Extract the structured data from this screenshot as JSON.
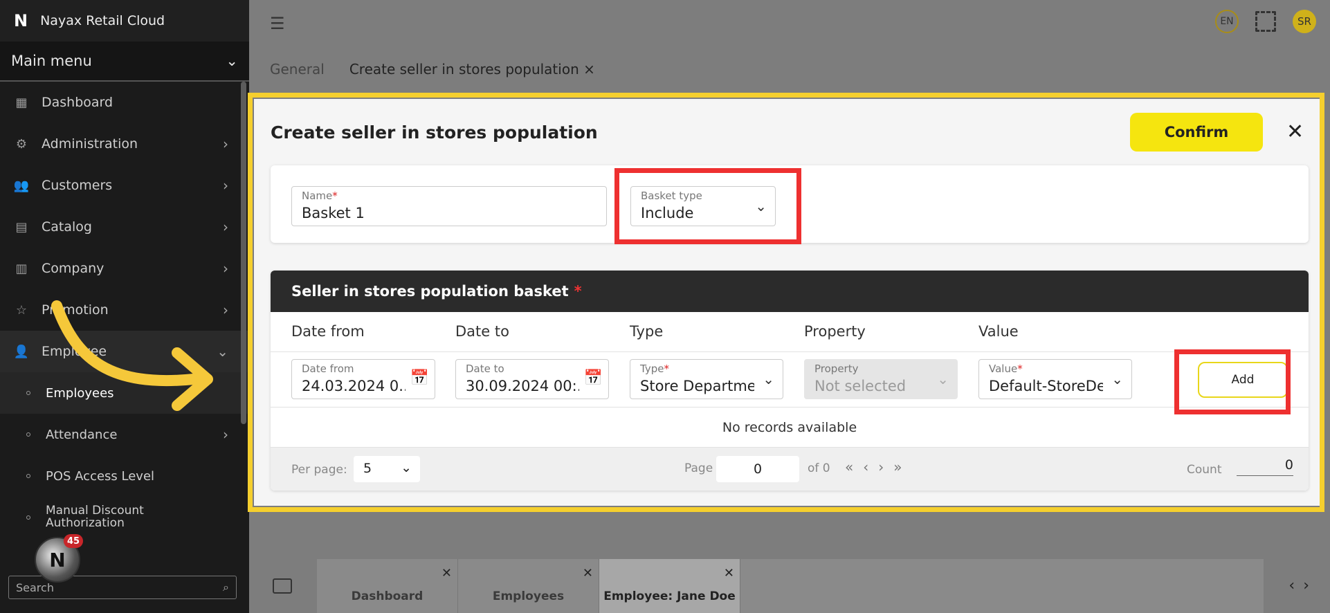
{
  "app": {
    "logo": "N",
    "title": "Nayax Retail Cloud"
  },
  "sidebar": {
    "main_menu": "Main menu",
    "items": [
      {
        "label": "Dashboard",
        "icon": "dashboard-icon"
      },
      {
        "label": "Administration",
        "icon": "gear-icon"
      },
      {
        "label": "Customers",
        "icon": "users-icon"
      },
      {
        "label": "Catalog",
        "icon": "grid-icon"
      },
      {
        "label": "Company",
        "icon": "building-icon"
      },
      {
        "label": "Promotion",
        "icon": "star-icon"
      },
      {
        "label": "Employee",
        "icon": "user-icon"
      }
    ],
    "subitems": [
      "Employees",
      "Attendance",
      "POS Access Level",
      "Manual Discount Authorization"
    ],
    "search_placeholder": "Search",
    "badge": "45"
  },
  "topbar": {
    "lang": "EN",
    "user": "SR"
  },
  "tabs": [
    "General",
    "Create seller in stores population"
  ],
  "modal": {
    "title": "Create seller in stores population",
    "confirm": "Confirm",
    "name_label": "Name",
    "name_value": "Basket 1",
    "basket_type_label": "Basket type",
    "basket_type_value": "Include",
    "basket_header": "Seller in stores population basket",
    "columns": [
      "Date from",
      "Date to",
      "Type",
      "Property",
      "Value"
    ],
    "row": {
      "date_from_label": "Date from",
      "date_from_value": "24.03.2024 0...",
      "date_to_label": "Date to",
      "date_to_value": "30.09.2024 00:...",
      "type_label": "Type",
      "type_value": "Store Departmer",
      "property_label": "Property",
      "property_value": "Not selected",
      "value_label": "Value",
      "value_value": "Default-StoreDe",
      "add": "Add"
    },
    "no_records": "No records available",
    "pager": {
      "per_page_label": "Per page:",
      "per_page": "5",
      "page_label": "Page",
      "page": "0",
      "of": "of 0",
      "count_label": "Count",
      "count": "0"
    }
  },
  "bottom_tabs": [
    "Dashboard",
    "Employees",
    "Employee: Jane Doe"
  ]
}
